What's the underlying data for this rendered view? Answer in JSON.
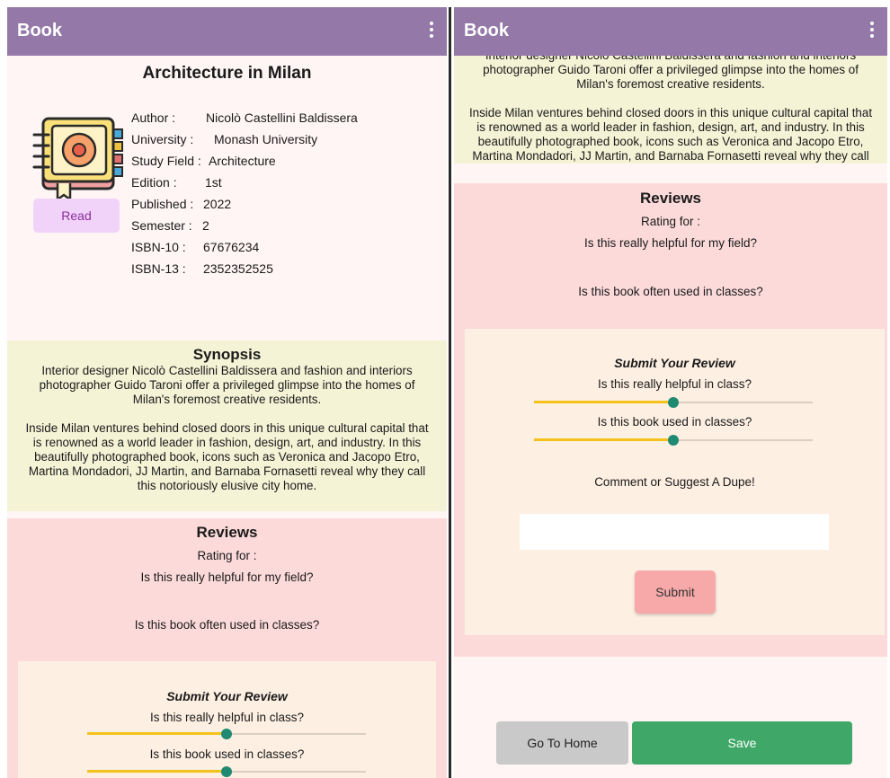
{
  "appbar": {
    "title": "Book"
  },
  "book": {
    "title": "Architecture in Milan",
    "read_label": "Read",
    "meta": [
      {
        "key": "Author :",
        "value": "Nicolò Castellini Baldissera"
      },
      {
        "key": "University :",
        "value": "Monash University"
      },
      {
        "key": "Study Field :",
        "value": "Architecture"
      },
      {
        "key": "Edition :",
        "value": "1st"
      },
      {
        "key": "Published :",
        "value": "2022"
      },
      {
        "key": "Semester :",
        "value": "2"
      },
      {
        "key": "ISBN-10 :",
        "value": "67676234"
      },
      {
        "key": "ISBN-13 :",
        "value": "2352352525"
      }
    ]
  },
  "synopsis": {
    "heading": "Synopsis",
    "paragraph1_lines": [
      "Interior designer Nicolò Castellini Baldissera and fashion and interiors",
      "photographer Guido Taroni offer a privileged glimpse into the homes of",
      "Milan's foremost creative residents."
    ],
    "paragraph2_lines": [
      "Inside Milan ventures behind closed doors in this unique cultural capital that",
      "is renowned as a world leader in fashion, design, art, and industry. In this",
      "beautifully photographed book, icons such as Veronica and Jacopo Etro,",
      "Martina Mondadori, JJ Martin, and Barnaba Fornasetti reveal why they call",
      "this notoriously elusive city home."
    ]
  },
  "reviews": {
    "heading": "Reviews",
    "rating_for": "Rating for :",
    "q_field": "Is this really helpful for my field?",
    "q_classes": "Is this book often used in classes?"
  },
  "submit_review": {
    "heading": "Submit Your Review",
    "q_helpful": "Is this really helpful in class?",
    "q_used": "Is this book used in classes?",
    "helpful_level": 0.5,
    "used_level": 0.5,
    "comment_label": "Comment or Suggest A Dupe!",
    "comment_value": "",
    "submit_label": "Submit"
  },
  "footer": {
    "home_label": "Go To Home",
    "save_label": "Save"
  },
  "colors": {
    "appbar": "#9378a8",
    "synopsis_bg": "#f5f3d6",
    "reviews_bg": "#fcdada",
    "slider_fill": "#f4c21a",
    "slider_thumb": "#1f8a72",
    "save": "#3fa868"
  }
}
